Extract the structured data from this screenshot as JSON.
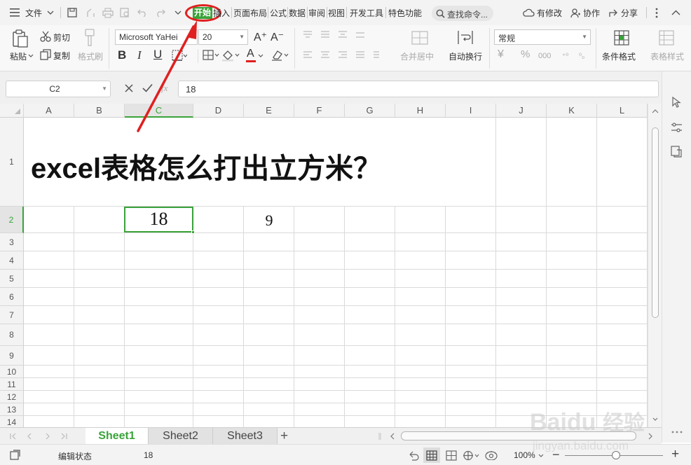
{
  "menubar": {
    "file_label": "文件",
    "tabs": [
      "开始",
      "插入",
      "页面布局",
      "公式",
      "数据",
      "审阅",
      "视图",
      "开发工具",
      "特色功能"
    ],
    "search_label": "查找命令...",
    "modified_label": "有修改",
    "collab_label": "协作",
    "share_label": "分享"
  },
  "ribbon": {
    "paste_label": "粘贴",
    "cut_label": "剪切",
    "copy_label": "复制",
    "format_painter_label": "格式刷",
    "font_name": "Microsoft YaHei",
    "font_size": "20",
    "merge_label": "合并居中",
    "wrap_label": "自动换行",
    "number_format": "常规",
    "cond_format_label": "条件格式",
    "table_style_label": "表格样式",
    "bold": "B",
    "italic": "I",
    "underline": "U",
    "grow_font": "A⁺",
    "shrink_font": "A⁻",
    "font_color_letter": "A",
    "currency_symbol": "¥",
    "percent_symbol": "%",
    "accent_color": "#3aa33a",
    "font_color": "#e02020"
  },
  "formulabar": {
    "cell_ref": "C2",
    "fx_label": "fx",
    "value": "18"
  },
  "grid": {
    "columns": [
      "A",
      "B",
      "C",
      "D",
      "E",
      "F",
      "G",
      "H",
      "I",
      "J",
      "K",
      "L"
    ],
    "rows": [
      "1",
      "2",
      "3",
      "4",
      "5",
      "6",
      "7",
      "8",
      "9",
      "10",
      "11",
      "12",
      "13",
      "14"
    ],
    "title": "excel表格怎么打出立方米？",
    "c2_value": "18",
    "e2_value": "9",
    "selected_cell": "C2"
  },
  "sheets": {
    "tabs": [
      "Sheet1",
      "Sheet2",
      "Sheet3"
    ],
    "active": "Sheet1",
    "add_label": "+"
  },
  "status": {
    "mode": "编辑状态",
    "value": "18",
    "zoom": "100%",
    "zoom_minus": "−",
    "zoom_plus": "+"
  },
  "annotation_color": "#e02020",
  "watermark_text": "Baidu 经验",
  "watermark_url": "jingyan.baidu.com"
}
